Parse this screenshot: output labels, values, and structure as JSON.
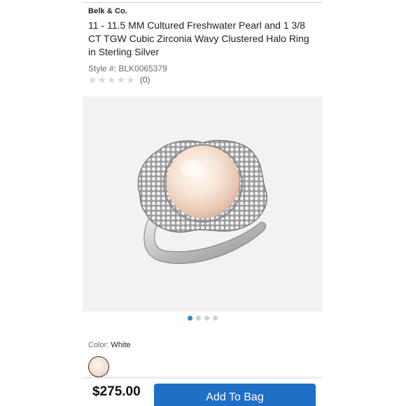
{
  "product": {
    "brand": "Belk & Co.",
    "title": "11 - 11.5 MM Cultured Freshwater Pearl and 1 3/8 CT TGW Cubic Zirconia Wavy Clustered Halo Ring in Sterling Silver",
    "style_label": "Style #:",
    "style_number": "BLK0065379",
    "rating": {
      "stars_filled": 0,
      "stars_total": 5,
      "review_count": "(0)"
    },
    "image": {
      "icon": "pearl-ring-image",
      "carousel_count": 4,
      "carousel_active_index": 0
    },
    "color": {
      "label": "Color:",
      "value": "White",
      "swatch_color": "#f2dccd"
    }
  },
  "purchase": {
    "price": "$275.00",
    "add_to_bag_label": "Add To Bag",
    "button_color": "#1f6fc6"
  },
  "colors": {
    "accent": "#1f6fc6",
    "carousel_active": "#3a86c8",
    "star_empty": "#d8d8d8"
  }
}
